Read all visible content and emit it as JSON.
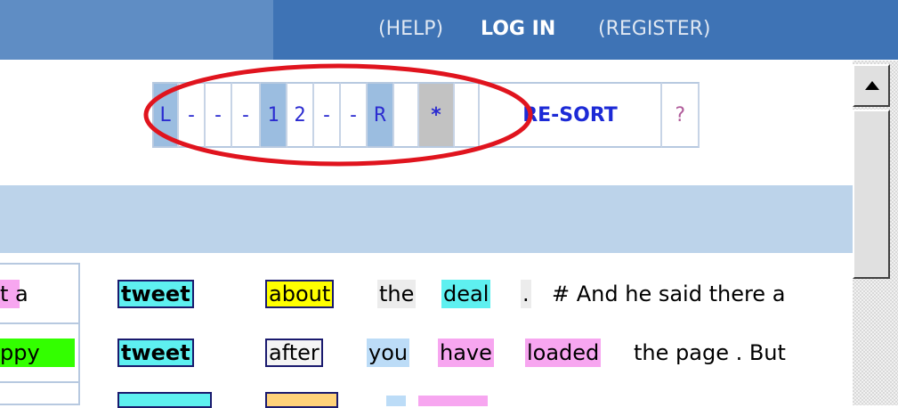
{
  "header": {
    "help_label": "(HELP)",
    "login_label": "LOG IN",
    "register_label": "(REGISTER)"
  },
  "pager": {
    "cells": [
      {
        "label": "L",
        "active": true
      },
      {
        "label": "-",
        "active": false
      },
      {
        "label": "-",
        "active": false
      },
      {
        "label": "-",
        "active": false
      },
      {
        "label": "1",
        "active": true
      },
      {
        "label": "2",
        "active": false
      },
      {
        "label": "-",
        "active": false
      },
      {
        "label": "-",
        "active": false
      },
      {
        "label": "R",
        "active": true
      }
    ],
    "star_label": "*",
    "resort_label": "RE-SORT",
    "help_label": "?"
  },
  "rows": [
    {
      "left_fragment": "t a",
      "keyword": "tweet",
      "tokens": [
        "about",
        "the",
        "deal",
        ".",
        "# And he said there a"
      ]
    },
    {
      "left_fragment": "ppy",
      "keyword": "tweet",
      "tokens": [
        "after",
        "you",
        "have",
        "loaded",
        "the page . But"
      ]
    }
  ],
  "colors": {
    "topbar_left": "#5f8dc4",
    "topbar_right": "#3e73b5",
    "band": "#bcd3ea",
    "highlight_circle": "#e0141e",
    "cyan": "#5ef0f0",
    "yellow": "#ffff00",
    "pink": "#f7a6f0",
    "lightblue": "#bcdcf7",
    "green": "#33ff00"
  }
}
